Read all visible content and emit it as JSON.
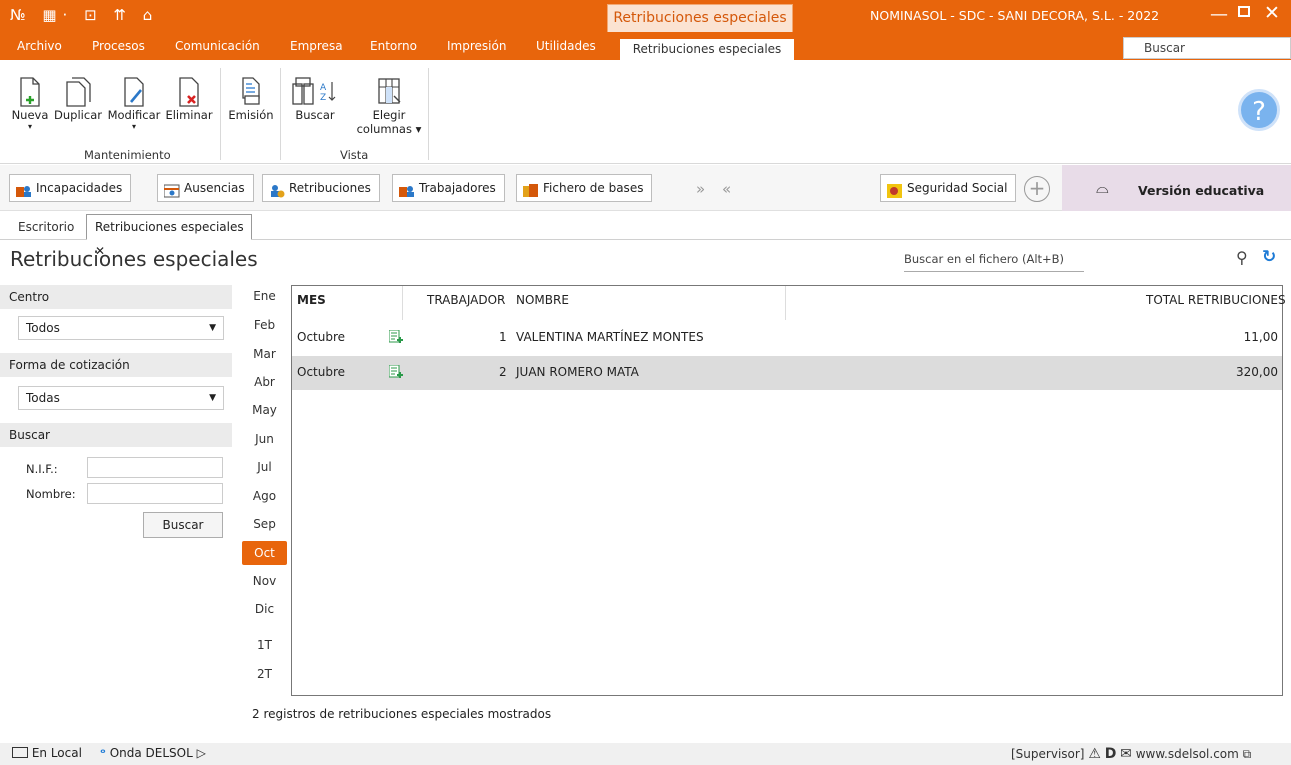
{
  "titlebar": {
    "quick_access": "№ ▦· ⊡ ⇈ ⌂",
    "context_title": "Retribuciones especiales",
    "window_title": "NOMINASOL - SDC - SANI DECORA, S.L. - 2022"
  },
  "menu": {
    "items": [
      "Archivo",
      "Procesos",
      "Comunicación",
      "Empresa",
      "Entorno",
      "Impresión",
      "Utilidades"
    ],
    "context_tab": "Retribuciones especiales",
    "search_placeholder": "Buscar"
  },
  "ribbon": {
    "mantenimiento": {
      "label": "Mantenimiento",
      "buttons": [
        "Nueva",
        "Duplicar",
        "Modificar",
        "Eliminar"
      ]
    },
    "emision": "Emisión",
    "vista": {
      "label": "Vista",
      "buscar": "Buscar",
      "elegir": "Elegir",
      "columnas": "columnas ▾"
    }
  },
  "shortcuts": {
    "items": [
      "Incapacidades",
      "Ausencias",
      "Retribuciones",
      "Trabajadores",
      "Fichero de bases"
    ],
    "arrows": "» «",
    "seguridad_social": "Seguridad Social",
    "edu_label": "Versión educativa"
  },
  "tabs": {
    "escritorio": "Escritorio",
    "active": "Retribuciones especiales ✕"
  },
  "page": {
    "title": "Retribuciones especiales",
    "search_file_placeholder": "Buscar en el fichero (Alt+B)",
    "status": "2 registros de retribuciones especiales mostrados"
  },
  "filters": {
    "centro_label": "Centro",
    "centro_value": "Todos",
    "forma_label": "Forma de cotización",
    "forma_value": "Todas",
    "buscar_label": "Buscar",
    "nif_label": "N.I.F.:",
    "nombre_label": "Nombre:",
    "buscar_button": "Buscar"
  },
  "months": [
    "Ene",
    "Feb",
    "Mar",
    "Abr",
    "May",
    "Jun",
    "Jul",
    "Ago",
    "Sep",
    "Oct",
    "Nov",
    "Dic",
    "1T",
    "2T"
  ],
  "selected_month": "Oct",
  "table": {
    "headers": [
      "MES",
      "TRABAJADOR",
      "NOMBRE",
      "TOTAL RETRIBUCIONES"
    ],
    "rows": [
      {
        "mes": "Octubre",
        "trabajador": "1",
        "nombre": "VALENTINA MARTÍNEZ MONTES",
        "total": "11,00"
      },
      {
        "mes": "Octubre",
        "trabajador": "2",
        "nombre": "JUAN ROMERO MATA",
        "total": "320,00"
      }
    ]
  },
  "bottombar": {
    "local": "En Local",
    "onda": "Onda DELSOL",
    "supervisor": "[Supervisor]",
    "website": "www.sdelsol.com"
  },
  "colors": {
    "accent": "#e8650c",
    "edu_bg": "#e8dce8",
    "selected_row": "#dcdcdc"
  }
}
